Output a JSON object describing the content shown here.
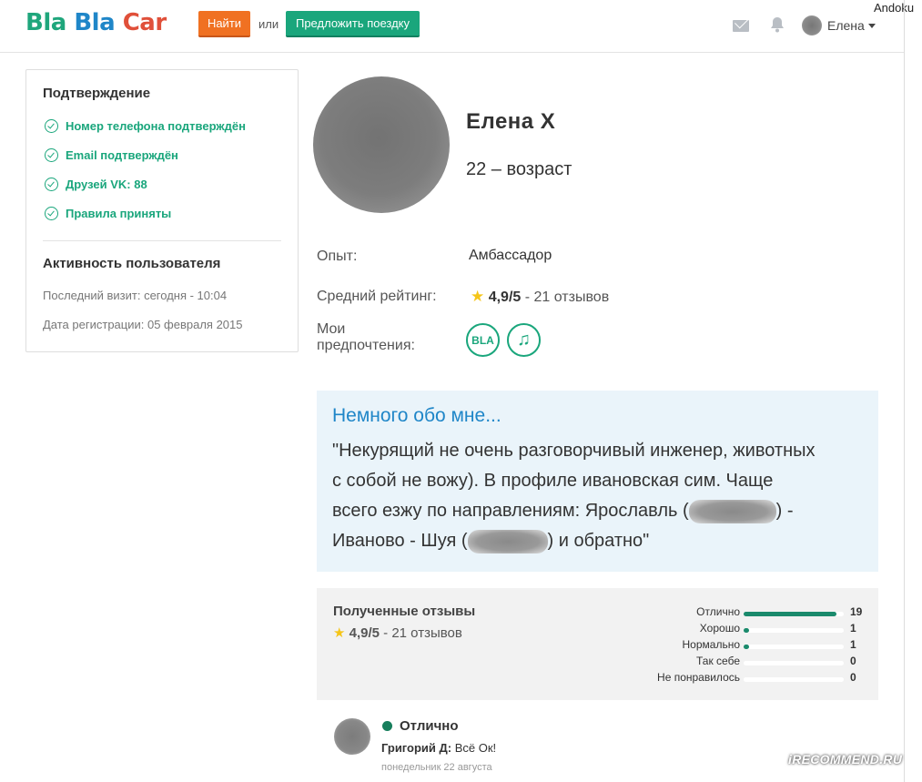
{
  "header": {
    "logo": {
      "part1": "Bla",
      "part2": "Bla",
      "part3": "Car"
    },
    "find_label": "Найти",
    "or_label": "или",
    "offer_label": "Предложить поездку",
    "user_name": "Елена",
    "icons": [
      "mail-icon",
      "bell-icon",
      "caret-down-icon"
    ]
  },
  "watermark_top": "Andoku",
  "verification": {
    "title": "Подтверждение",
    "items": [
      {
        "label": "Номер телефона подтверждён"
      },
      {
        "label": "Email подтверждён"
      },
      {
        "label": "Друзей VK: 88"
      },
      {
        "label": "Правила приняты"
      }
    ]
  },
  "activity": {
    "title": "Активность пользователя",
    "last_visit": "Последний визит: сегодня - 10:04",
    "registered": "Дата регистрации: 05 февраля 2015"
  },
  "profile": {
    "name": "Елена Х",
    "age": "22 – возраст",
    "experience_label": "Опыт:",
    "experience_value": "Амбассадор",
    "rating_label": "Средний рейтинг:",
    "rating_value": "4,9/5",
    "rating_reviews": " - 21 отзывов",
    "prefs_label_1": "Мои",
    "prefs_label_2": "предпочтения:",
    "pref_bla": "BLA",
    "pref_music": "♫"
  },
  "about": {
    "title": "Немного обо мне...",
    "line1": "\"Некурящий не очень разговорчивый инженер, животных",
    "line2": "с собой не вожу). В профиле ивановская сим. Чаще",
    "line3a": "всего езжу по направлениям: Ярославль (",
    "line3b": ") -",
    "line4a": "Иваново - Шуя (",
    "line4b": ") и обратно\""
  },
  "reviews_summary": {
    "title": "Полученные отзывы",
    "rating_value": "4,9/5",
    "rating_reviews": " - 21 отзывов",
    "bars": [
      {
        "label": "Отлично",
        "count": "19",
        "fraction": 0.93
      },
      {
        "label": "Хорошо",
        "count": "1",
        "fraction": 0.05
      },
      {
        "label": "Нормально",
        "count": "1",
        "fraction": 0.05
      },
      {
        "label": "Так себе",
        "count": "0",
        "fraction": 0
      },
      {
        "label": "Не понравилось",
        "count": "0",
        "fraction": 0
      }
    ]
  },
  "review": {
    "grade": "Отлично",
    "author": "Григорий Д:",
    "text": " Всё Ок!",
    "date": "понедельник 22 августа"
  },
  "watermark_bottom": "iRECOMMEND.RU",
  "colors": {
    "green": "#1aa67c",
    "orange": "#f07122",
    "blue": "#1f86c8",
    "about_bg": "#eaf4fa"
  }
}
